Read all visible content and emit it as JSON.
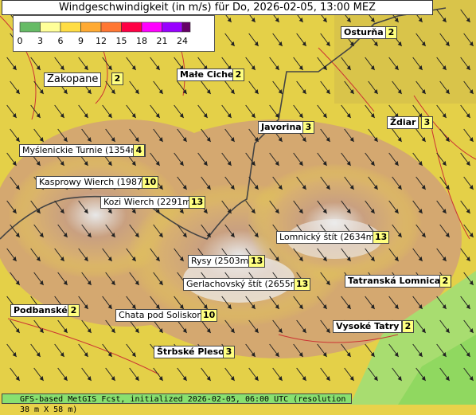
{
  "title": "Windgeschwindigkeit (in m/s) für Do, 2026-02-05, 13:00 MEZ",
  "legend": {
    "ticks": [
      "0",
      "3",
      "6",
      "9",
      "12",
      "15",
      "18",
      "21",
      "24"
    ],
    "colors": [
      "#66bb66",
      "#ffff99",
      "#ffdd44",
      "#ffaa33",
      "#ff7733",
      "#ff0044",
      "#ff00ff",
      "#9900ff",
      "#660066"
    ]
  },
  "places": [
    {
      "name": "Zakopane",
      "value": "2"
    },
    {
      "name": "Małe Ciche",
      "value": "2"
    },
    {
      "name": "Osturňa",
      "value": "2"
    },
    {
      "name": "Javorina",
      "value": "3"
    },
    {
      "name": "Ždiar",
      "value": "3"
    },
    {
      "name": "Myślenickie Turnie (1354m)",
      "value": "4"
    },
    {
      "name": "Kasprowy Wierch (1987m)",
      "value": "10"
    },
    {
      "name": "Kozi Wierch (2291m)",
      "value": "13"
    },
    {
      "name": "Lomnický štít (2634m)",
      "value": "13"
    },
    {
      "name": "Rysy (2503m)",
      "value": "13"
    },
    {
      "name": "Gerlachovský štít (2655m)",
      "value": "13"
    },
    {
      "name": "Tatranská Lomnica",
      "value": "2"
    },
    {
      "name": "Podbanské",
      "value": "2"
    },
    {
      "name": "Chata pod Soliskom",
      "value": "10"
    },
    {
      "name": "Vysoké Tatry",
      "value": "2"
    },
    {
      "name": "Štrbské Pleso",
      "value": "3"
    }
  ],
  "footer": "GFS-based MetGIS Fcst, initialized 2026-02-05, 06:00 UTC  (resolution 38 m X 58 m)"
}
